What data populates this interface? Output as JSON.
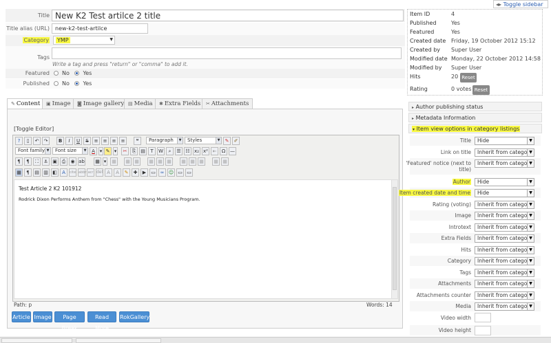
{
  "toggle_sidebar": "Toggle sidebar",
  "form": {
    "title_label": "Title",
    "title_value": "New K2 Test artilce 2 title",
    "alias_label": "Title alias (URL)",
    "alias_value": "new-k2-test-artilce",
    "category_label": "Category",
    "category_value": "YMP",
    "tags_label": "Tags",
    "tags_hint": "Write a tag and press \"return\" or \"comma\" to add it.",
    "featured_label": "Featured",
    "published_label": "Published",
    "no_label": "No",
    "yes_label": "Yes"
  },
  "tabs": [
    {
      "label": "Content",
      "icon": "content-icon"
    },
    {
      "label": "Image",
      "icon": "image-icon"
    },
    {
      "label": "Image gallery",
      "icon": "gallery-icon"
    },
    {
      "label": "Media",
      "icon": "media-icon"
    },
    {
      "label": "Extra Fields",
      "icon": "extra-fields-icon"
    },
    {
      "label": "Attachments",
      "icon": "attachments-icon"
    }
  ],
  "editor": {
    "toggle": "[Toggle Editor]",
    "format_select": "Paragraph",
    "styles_select": "Styles",
    "font_family": "Font family",
    "font_size": "Font size",
    "line1": "Test Article 2 K2 101912",
    "line2": "Rodrick Dixon Performs Anthem from \"Chess\" with the Young Musicians Program.",
    "path": "Path:  p",
    "words": "Words: 14"
  },
  "editor_buttons": [
    "Article",
    "Image",
    "Page Break",
    "Read More",
    "RokGallery"
  ],
  "info": [
    {
      "label": "Item ID",
      "value": "4"
    },
    {
      "label": "Published",
      "value": "Yes"
    },
    {
      "label": "Featured",
      "value": "Yes"
    },
    {
      "label": "Created date",
      "value": "Friday, 19 October 2012 15:12"
    },
    {
      "label": "Created by",
      "value": "Super User"
    },
    {
      "label": "Modified date",
      "value": "Monday, 22 October 2012 14:58"
    },
    {
      "label": "Modified by",
      "value": "Super User"
    },
    {
      "label": "Hits",
      "value": "20"
    },
    {
      "label": "Rating",
      "value": "0 votes"
    }
  ],
  "reset_label": "Reset",
  "panels": {
    "author": "Author publishing status",
    "metadata": "Metadata Information",
    "item_view": "Item view options in category listings"
  },
  "options": [
    {
      "label": "Title",
      "value": "Hide"
    },
    {
      "label": "Link on title",
      "value": "Inherit from category"
    },
    {
      "label": "'Featured' notice (next to",
      "label2": "title)",
      "value": "Inherit from category"
    },
    {
      "label": "Author",
      "value": "Hide"
    },
    {
      "label": "Item created date and time",
      "value": "Hide"
    },
    {
      "label": "Rating (voting)",
      "value": "Inherit from category"
    },
    {
      "label": "Image",
      "value": "Inherit from category"
    },
    {
      "label": "Introtext",
      "value": "Inherit from category"
    },
    {
      "label": "Extra Fields",
      "value": "Inherit from category"
    },
    {
      "label": "Hits",
      "value": "Inherit from category"
    },
    {
      "label": "Category",
      "value": "Inherit from category"
    },
    {
      "label": "Tags",
      "value": "Inherit from category"
    },
    {
      "label": "Attachments",
      "value": "Inherit from category"
    },
    {
      "label": "Attachments counter",
      "value": "Inherit from category"
    },
    {
      "label": "Media",
      "value": "Inherit from category"
    },
    {
      "label": "Video width",
      "value": ""
    },
    {
      "label": "Video height",
      "value": ""
    }
  ],
  "colors": {
    "highlight": "#f8f842",
    "button_blue": "#4b8fd4"
  }
}
